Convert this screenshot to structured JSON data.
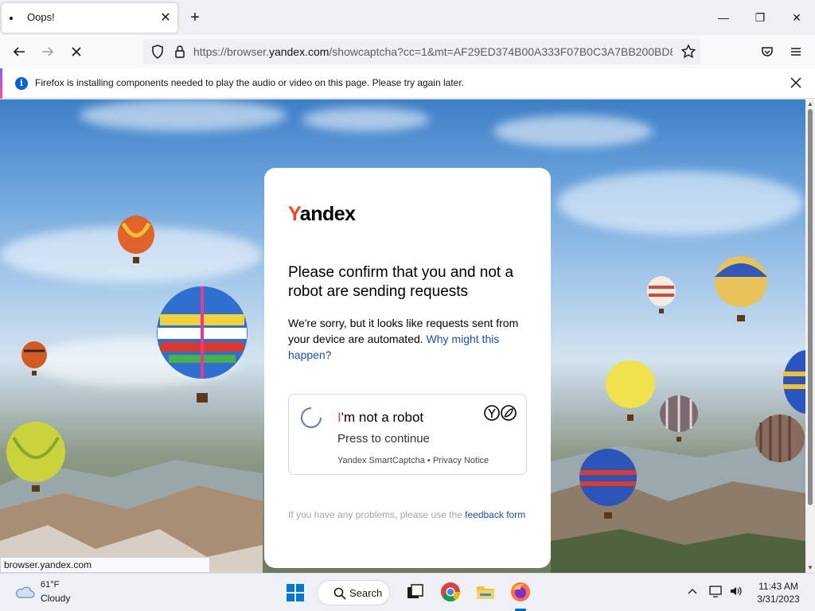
{
  "browser": {
    "tab_title": "Oops!",
    "tab_close": "✕",
    "new_tab": "+",
    "window_controls": {
      "minimize": "—",
      "maximize": "❐",
      "close": "✕"
    },
    "url_prefix": "https://browser.",
    "url_domain": "yandex.com",
    "url_suffix": "/showcaptcha?cc=1&mt=AF29ED374B00A333F07B0C3A7BB200BD81",
    "notification": "Firefox is installing components needed to play the audio or video on this page. Please try again later.",
    "notification_info_glyph": "i",
    "status_url": "browser.yandex.com"
  },
  "card": {
    "logo_first": "Y",
    "logo_rest": "andex",
    "heading": "Please confirm that you and not a robot are sending requests",
    "desc": "We're sorry, but it looks like requests sent from your device are automated.",
    "desc_link": "Why might this happen?",
    "robot_first": "I",
    "robot_rest": "'m not a robot",
    "press": "Press to continue",
    "smart": "Yandex SmartCaptcha",
    "sep": " • ",
    "privacy": "Privacy Notice",
    "problems": "If you have any problems, please use the",
    "feedback": "feedback form"
  },
  "taskbar": {
    "temp": "61°F",
    "condition": "Cloudy",
    "search": "Search",
    "time": "11:43 AM",
    "date": "3/31/2023"
  },
  "colors": {
    "yandex_red": "#fc3f1d",
    "link": "#1a4e9c",
    "firefox_accent": "#0060df"
  }
}
